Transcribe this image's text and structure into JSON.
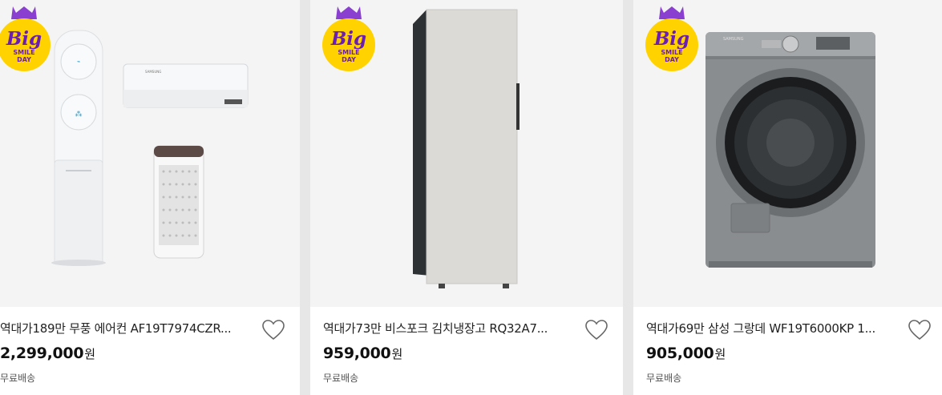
{
  "badge": {
    "top": "Big",
    "line1": "SMILE",
    "line2": "DAY"
  },
  "colors": {
    "badge_yellow": "#ffd200",
    "badge_purple": "#6a1fb0",
    "crown": "#8a3fd1"
  },
  "products": [
    {
      "title": "역대가189만 무풍 에어컨 AF19T7974CZR...",
      "price": "2,299,000",
      "unit": "원",
      "shipping": "무료배송",
      "image": "air-conditioner-set"
    },
    {
      "title": "역대가73만 비스포크 김치냉장고 RQ32A7...",
      "price": "959,000",
      "unit": "원",
      "shipping": "무료배송",
      "image": "kimchi-refrigerator"
    },
    {
      "title": "역대가69만 삼성 그랑데 WF19T6000KP 1...",
      "price": "905,000",
      "unit": "원",
      "shipping": "무료배송",
      "image": "washing-machine"
    }
  ],
  "brand_label": "SAMSUNG",
  "wishlist_icon": "heart-icon"
}
